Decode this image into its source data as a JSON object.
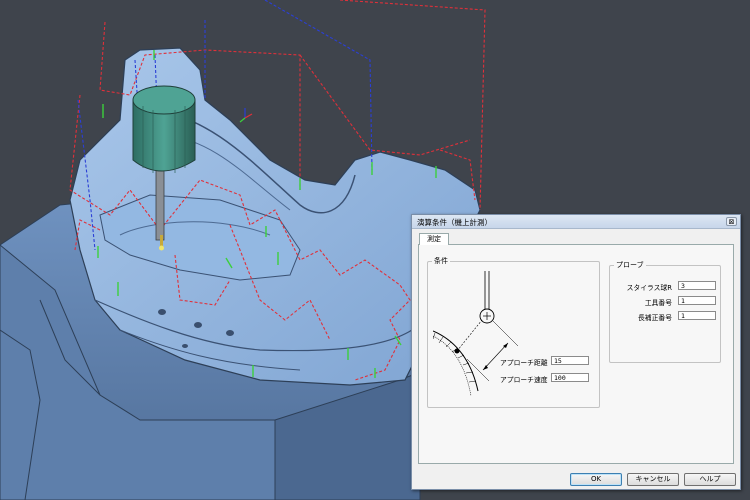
{
  "dialog": {
    "title": "演算条件（機上計測）",
    "close_label": "⊠",
    "tabs": [
      {
        "label": "測定"
      }
    ],
    "condition_group": {
      "legend": "条件",
      "approach_distance_label": "アプローチ距離",
      "approach_distance_value": "15",
      "approach_speed_label": "アプローチ速度",
      "approach_speed_value": "100"
    },
    "probe_group": {
      "legend": "プローブ",
      "stylus_radius_label": "スタイラス球R",
      "stylus_radius_value": "3",
      "tool_number_label": "工具番号",
      "tool_number_value": "1",
      "length_offset_label": "長補正番号",
      "length_offset_value": "1"
    },
    "buttons": {
      "ok": "OK",
      "cancel": "キャンセル",
      "help": "ヘルプ"
    }
  },
  "colors": {
    "background": "#3f444c",
    "part": "#8fb3de",
    "toolpath_red": "#e0303a",
    "toolpath_blue": "#2b3fd6",
    "marker_green": "#3cd03c",
    "tool_body": "#3f8a7c"
  }
}
